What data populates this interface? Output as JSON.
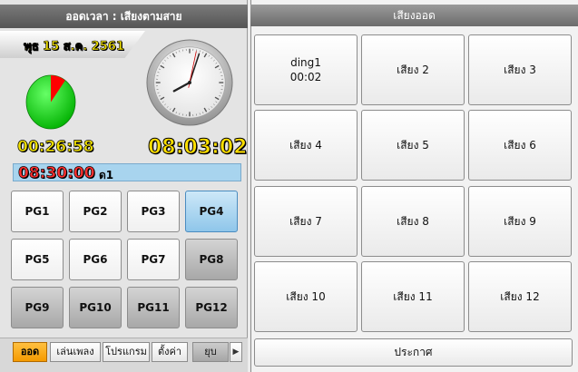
{
  "left_panel": {
    "title": "ออดเวลา : เสียงตามสาย",
    "date": "พุธ  15 ส.ค. 2561",
    "elapsed": "00:26:58",
    "current_time": "08:03:02",
    "clock": {
      "hours": 8,
      "minutes": 3,
      "seconds": 2
    },
    "pie": {
      "fraction_elapsed": 0.1
    },
    "next_schedule": {
      "time": "08:30:00",
      "label": "ด1"
    },
    "program_buttons": [
      {
        "label": "PG1",
        "state": "normal"
      },
      {
        "label": "PG2",
        "state": "normal"
      },
      {
        "label": "PG3",
        "state": "normal"
      },
      {
        "label": "PG4",
        "state": "selected"
      },
      {
        "label": "PG5",
        "state": "normal"
      },
      {
        "label": "PG6",
        "state": "normal"
      },
      {
        "label": "PG7",
        "state": "normal"
      },
      {
        "label": "PG8",
        "state": "muted"
      },
      {
        "label": "PG9",
        "state": "muted"
      },
      {
        "label": "PG10",
        "state": "muted"
      },
      {
        "label": "PG11",
        "state": "muted"
      },
      {
        "label": "PG12",
        "state": "muted"
      }
    ],
    "footer_tabs": [
      {
        "label": "ออด",
        "state": "active"
      },
      {
        "label": "เล่นเพลง",
        "state": "normal"
      },
      {
        "label": "โปรแกรม",
        "state": "normal"
      },
      {
        "label": "ตั้งค่า",
        "state": "normal"
      },
      {
        "label": "ยุบ",
        "state": "dark"
      }
    ],
    "footer_arrow": "▶"
  },
  "right_panel": {
    "title": "เสียงออด",
    "sound_buttons": [
      {
        "line1": "ding1",
        "line2": "00:02"
      },
      {
        "line1": "เสียง 2",
        "line2": ""
      },
      {
        "line1": "เสียง 3",
        "line2": ""
      },
      {
        "line1": "เสียง 4",
        "line2": ""
      },
      {
        "line1": "เสียง 5",
        "line2": ""
      },
      {
        "line1": "เสียง 6",
        "line2": ""
      },
      {
        "line1": "เสียง 7",
        "line2": ""
      },
      {
        "line1": "เสียง 8",
        "line2": ""
      },
      {
        "line1": "เสียง 9",
        "line2": ""
      },
      {
        "line1": "เสียง 10",
        "line2": ""
      },
      {
        "line1": "เสียง 11",
        "line2": ""
      },
      {
        "line1": "เสียง 12",
        "line2": ""
      }
    ],
    "announce_label": "ประกาศ"
  },
  "colors": {
    "selected_button": "#8fc6ea",
    "active_tab": "#f59a00",
    "pie_fill": "#00cc00",
    "pie_elapsed": "#ff0000",
    "digit_yellow": "#f0e000",
    "digit_red": "#ff3030"
  }
}
